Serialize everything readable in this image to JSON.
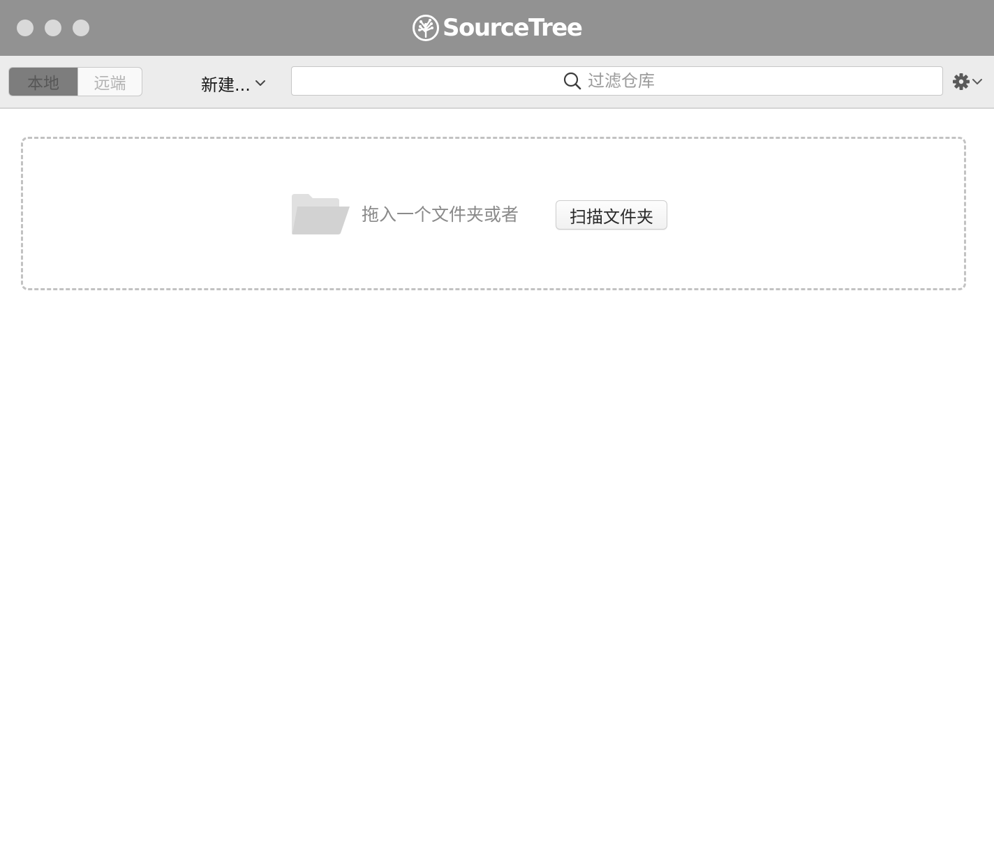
{
  "window": {
    "title": "SourceTree"
  },
  "toolbar": {
    "tabs": [
      {
        "label": "本地",
        "selected": true
      },
      {
        "label": "远端",
        "selected": false
      }
    ],
    "new_label": "新建...",
    "search_placeholder": "过滤仓库",
    "search_value": ""
  },
  "dropzone": {
    "hint": "拖入一个文件夹或者",
    "scan_button": "扫描文件夹"
  },
  "icons": {
    "app_logo": "sourcetree-tree-icon",
    "new_chevron": "chevron-down-icon",
    "search": "search-icon",
    "settings": "gear-icon",
    "settings_chevron": "chevron-down-icon",
    "folder": "folder-icon"
  },
  "colors": {
    "titlebar": "#929292",
    "toolbar": "#ececec",
    "selected_tab": "#7d7d7d",
    "traffic_light": "#d9d9d9"
  }
}
